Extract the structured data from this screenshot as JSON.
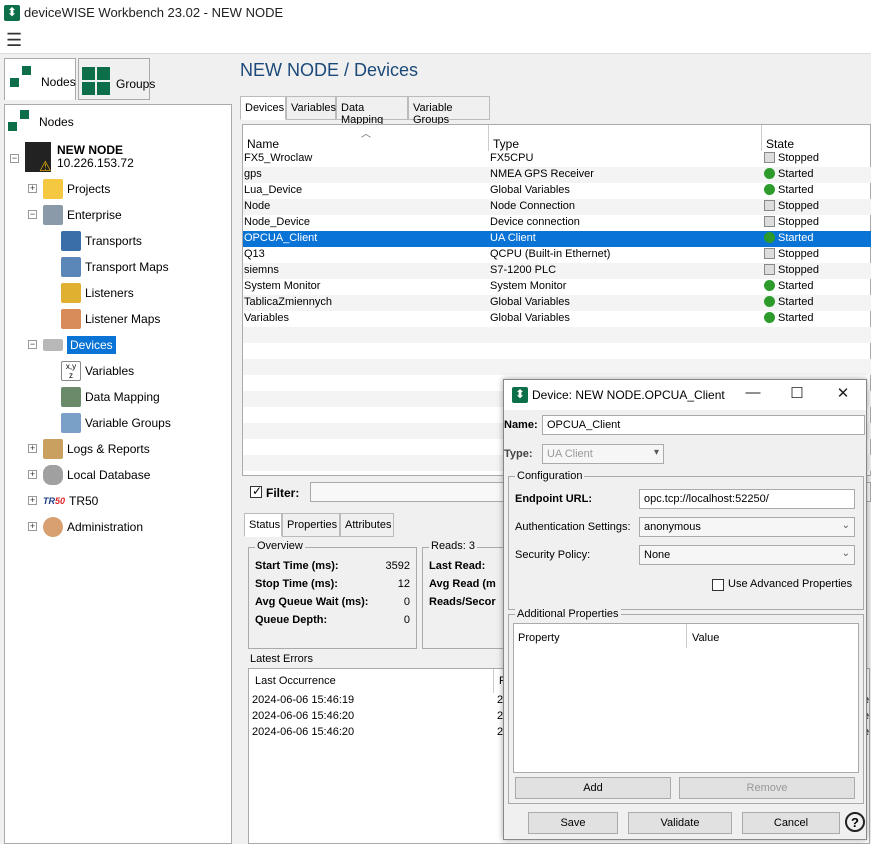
{
  "app": {
    "title": "deviceWISE Workbench 23.02  -  NEW NODE"
  },
  "left_tabs": {
    "nodes": "Nodes",
    "groups": "Groups"
  },
  "tree": {
    "root": "Nodes",
    "node_name": "NEW NODE",
    "node_ip": "10.226.153.72",
    "items": {
      "projects": "Projects",
      "enterprise": "Enterprise",
      "transports": "Transports",
      "transport_maps": "Transport Maps",
      "listeners": "Listeners",
      "listener_maps": "Listener Maps",
      "devices": "Devices",
      "variables": "Variables",
      "data_mapping": "Data Mapping",
      "variable_groups": "Variable Groups",
      "logs": "Logs & Reports",
      "local_db": "Local Database",
      "tr50": "TR50",
      "admin": "Administration"
    }
  },
  "main": {
    "title": "NEW NODE / Devices",
    "tabs": [
      "Devices",
      "Variables",
      "Data Mapping",
      "Variable Groups"
    ],
    "columns": [
      "Name",
      "Type",
      "State"
    ],
    "rows": [
      {
        "name": "FX5_Wroclaw",
        "type": "FX5CPU",
        "state": "Stopped"
      },
      {
        "name": "gps",
        "type": "NMEA GPS Receiver",
        "state": "Started"
      },
      {
        "name": "Lua_Device",
        "type": "Global Variables",
        "state": "Started"
      },
      {
        "name": "Node",
        "type": "Node Connection",
        "state": "Stopped"
      },
      {
        "name": "Node_Device",
        "type": "Device connection",
        "state": "Stopped"
      },
      {
        "name": "OPCUA_Client",
        "type": "UA Client",
        "state": "Started"
      },
      {
        "name": "Q13",
        "type": "QCPU (Built-in Ethernet)",
        "state": "Stopped"
      },
      {
        "name": "siemns",
        "type": "S7-1200 PLC",
        "state": "Stopped"
      },
      {
        "name": "System Monitor",
        "type": "System Monitor",
        "state": "Started"
      },
      {
        "name": "TablicaZmiennych",
        "type": "Global Variables",
        "state": "Started"
      },
      {
        "name": "Variables",
        "type": "Global Variables",
        "state": "Started"
      }
    ],
    "filter_label": "Filter:"
  },
  "bottom": {
    "tabs": [
      "Status",
      "Properties",
      "Attributes"
    ],
    "overview": {
      "legend": "Overview",
      "start_time_label": "Start Time (ms):",
      "start_time": "3592",
      "stop_time_label": "Stop Time (ms):",
      "stop_time": "12",
      "avg_queue_label": "Avg Queue Wait (ms):",
      "avg_queue": "0",
      "queue_depth_label": "Queue Depth:",
      "queue_depth": "0"
    },
    "reads": {
      "legend": "Reads: 3",
      "last_read": "Last Read:",
      "avg_read": "Avg Read (m",
      "reads_sec": "Reads/Secor"
    },
    "errors": {
      "legend": "Latest Errors",
      "col1": "Last Occurrence",
      "col2": "R",
      "rows": [
        {
          "t": "2024-06-06 15:46:19",
          "c": "2",
          "e": "e"
        },
        {
          "t": "2024-06-06 15:46:20",
          "c": "2",
          "e": "e"
        },
        {
          "t": "2024-06-06 15:46:20",
          "c": "2",
          "e": "e"
        }
      ]
    }
  },
  "dialog": {
    "title": "Device: NEW NODE.OPCUA_Client",
    "name_label": "Name:",
    "name_value": "OPCUA_Client",
    "type_label": "Type:",
    "type_value": "UA Client",
    "config_legend": "Configuration",
    "endpoint_label": "Endpoint URL:",
    "endpoint_value": "opc.tcp://localhost:52250/",
    "auth_label": "Authentication Settings:",
    "auth_value": "anonymous",
    "security_label": "Security Policy:",
    "security_value": "None",
    "advanced_label": "Use Advanced Properties",
    "additional_legend": "Additional Properties",
    "prop_col": "Property",
    "value_col": "Value",
    "add": "Add",
    "remove": "Remove",
    "save": "Save",
    "validate": "Validate",
    "cancel": "Cancel",
    "help": "?"
  }
}
